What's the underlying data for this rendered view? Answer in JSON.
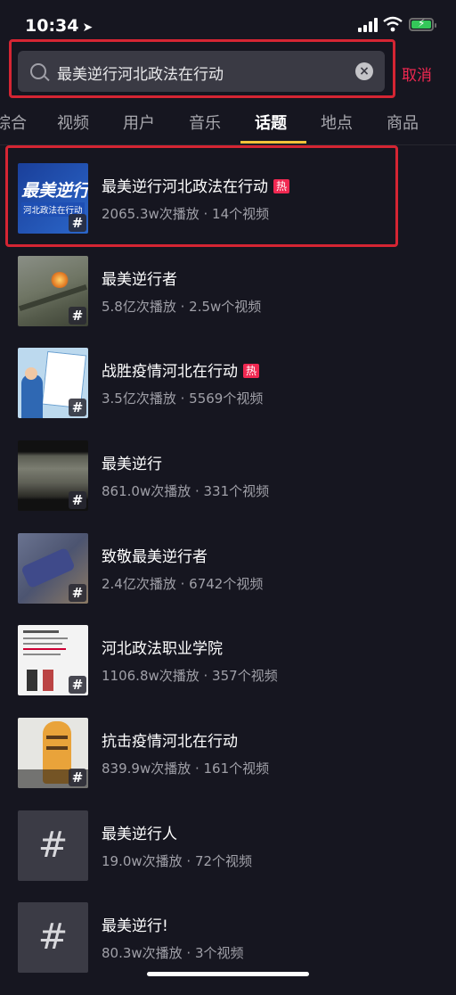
{
  "status_bar": {
    "time": "10:34"
  },
  "search": {
    "query": "最美逆行河北政法在行动",
    "cancel_label": "取消"
  },
  "tabs": [
    {
      "label": "综合"
    },
    {
      "label": "视频"
    },
    {
      "label": "用户"
    },
    {
      "label": "音乐"
    },
    {
      "label": "话题",
      "active": true
    },
    {
      "label": "地点"
    },
    {
      "label": "商品"
    }
  ],
  "results": [
    {
      "title": "最美逆行河北政法在行动",
      "hot": "热",
      "meta": "2065.3w次播放 · 14个视频",
      "thumb_text_1": "最美逆行",
      "thumb_text_2": "河北政法在行动"
    },
    {
      "title": "最美逆行者",
      "meta": "5.8亿次播放 · 2.5w个视频"
    },
    {
      "title": "战胜疫情河北在行动",
      "hot": "热",
      "meta": "3.5亿次播放 · 5569个视频"
    },
    {
      "title": "最美逆行",
      "meta": "861.0w次播放 · 331个视频"
    },
    {
      "title": "致敬最美逆行者",
      "meta": "2.4亿次播放 · 6742个视频"
    },
    {
      "title": "河北政法职业学院",
      "meta": "1106.8w次播放 · 357个视频"
    },
    {
      "title": "抗击疫情河北在行动",
      "meta": "839.9w次播放 · 161个视频"
    },
    {
      "title": "最美逆行人",
      "meta": "19.0w次播放 · 72个视频"
    },
    {
      "title": "最美逆行!",
      "meta": "80.3w次播放 · 3个视频"
    }
  ],
  "hash_symbol": "#",
  "colors": {
    "accent": "#f02851",
    "tab_underline": "#f2c23a",
    "outline": "#d52533"
  }
}
